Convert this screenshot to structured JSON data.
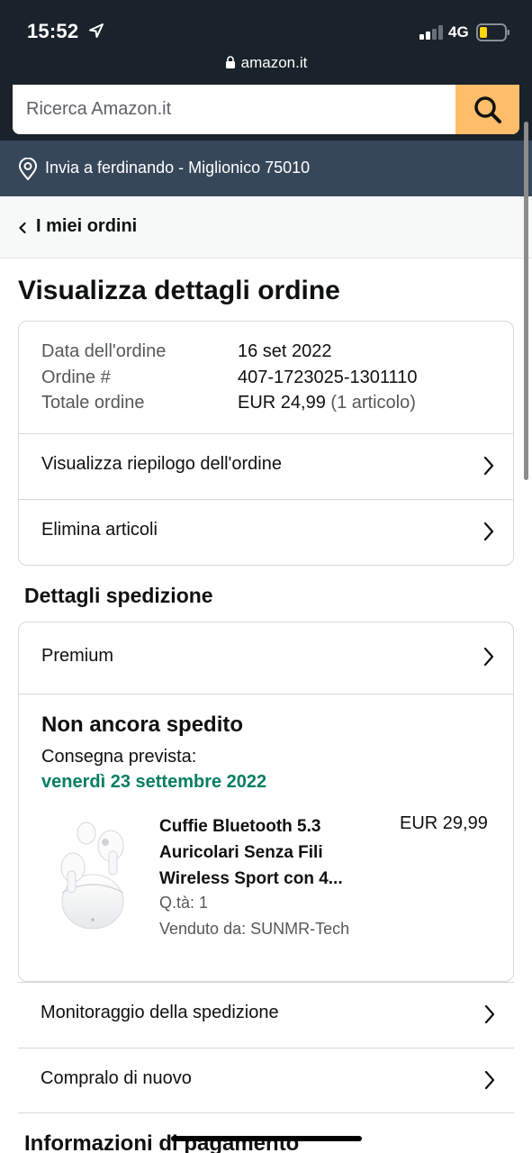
{
  "status_bar": {
    "time": "15:52",
    "network": "4G"
  },
  "browser": {
    "url": "amazon.it"
  },
  "search": {
    "placeholder": "Ricerca Amazon.it"
  },
  "deliver_to": "Invia a ferdinando - Miglionico 75010",
  "breadcrumb": {
    "label": "I miei ordini"
  },
  "page_title": "Visualizza dettagli ordine",
  "order_summary": {
    "date_label": "Data dell'ordine",
    "date_value": "16 set 2022",
    "number_label": "Ordine #",
    "number_value": "407-1723025-1301110",
    "total_label": "Totale ordine",
    "total_value": "EUR 24,99",
    "total_items": "(1 articolo)",
    "links": {
      "summary": "Visualizza riepilogo dell'ordine",
      "remove": "Elimina articoli"
    }
  },
  "shipping": {
    "section_title": "Dettagli spedizione",
    "method": "Premium",
    "status": "Non ancora spedito",
    "delivery_label": "Consegna prevista:",
    "delivery_date": "venerdì 23 settembre 2022",
    "product": {
      "title": "Cuffie Bluetooth 5.3 Auricolari Senza Fili Wireless Sport con 4...",
      "price": "EUR 29,99",
      "quantity": "Q.tà: 1",
      "seller": "Venduto da: SUNMR-Tech"
    }
  },
  "actions": {
    "track": "Monitoraggio della spedizione",
    "buy_again": "Compralo di nuovo"
  },
  "payment": {
    "section_title": "Informazioni di pagamento"
  },
  "colors": {
    "header": "#1a222b",
    "deliver_bar": "#37475a",
    "search_button": "#febd69",
    "delivery_green": "#067d62"
  },
  "icons": [
    "location-arrow-icon",
    "signal-icon",
    "battery-icon",
    "lock-icon",
    "search-icon",
    "location-pin-icon",
    "chevron-left-icon",
    "chevron-right-icon"
  ]
}
